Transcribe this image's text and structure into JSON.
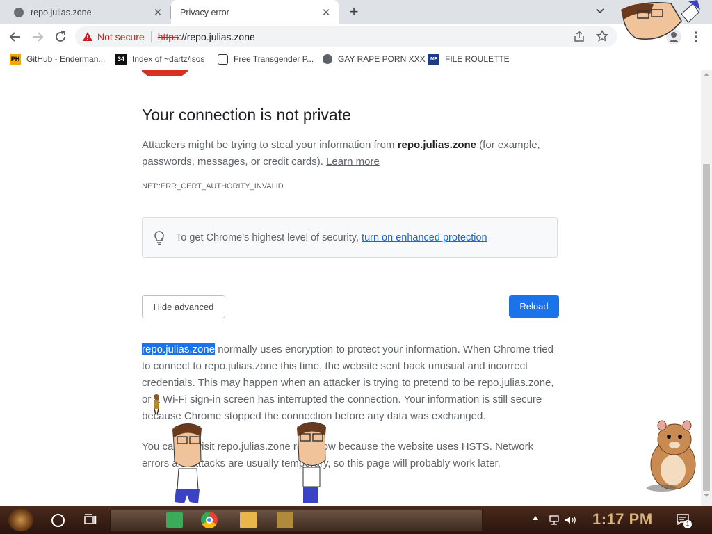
{
  "browser": {
    "tabs": [
      {
        "title": "repo.julias.zone",
        "active": false
      },
      {
        "title": "Privacy error",
        "active": true
      }
    ],
    "address": {
      "security_label": "Not secure",
      "url_scheme": "https",
      "url_rest": "://repo.julias.zone"
    },
    "bookmarks": [
      {
        "label": "GitHub - Enderman...",
        "icon": "PH"
      },
      {
        "label": "Index of ~dartz/isos",
        "icon": "34"
      },
      {
        "label": "Free Transgender P...",
        "icon": ""
      },
      {
        "label": "GAY RAPE PORN XXX",
        "icon": ""
      },
      {
        "label": "FILE ROULETTE",
        "icon": "MF"
      }
    ]
  },
  "page": {
    "heading": "Your connection is not private",
    "intro_pre": "Attackers might be trying to steal your information from ",
    "intro_host": "repo.julias.zone",
    "intro_post": " (for example, passwords, messages, or credit cards). ",
    "learn_more": "Learn more",
    "error_code": "NET::ERR_CERT_AUTHORITY_INVALID",
    "enhanced_text": "To get Chrome’s highest level of security, ",
    "enhanced_link": "turn on enhanced protection",
    "hide_advanced": "Hide advanced",
    "reload": "Reload",
    "details_host": "repo.julias.zone",
    "details_1": " normally uses encryption to protect your information. When Chrome tried to connect to repo.julias.zone this time, the website sent back unusual and incorrect credentials. This may happen when an attacker is trying to pretend to be repo.julias.zone, or a Wi-Fi sign-in screen has interrupted the connection. Your information is still secure because Chrome stopped the connection before any data was exchanged.",
    "details_2": "You cannot visit repo.julias.zone right now because the website uses HSTS. Network errors and attacks are usually temporary, so this page will probably work later."
  },
  "taskbar": {
    "clock": "1:17 PM",
    "notification_count": "1"
  },
  "colors": {
    "accent": "#1a73e8",
    "danger": "#d93025"
  }
}
